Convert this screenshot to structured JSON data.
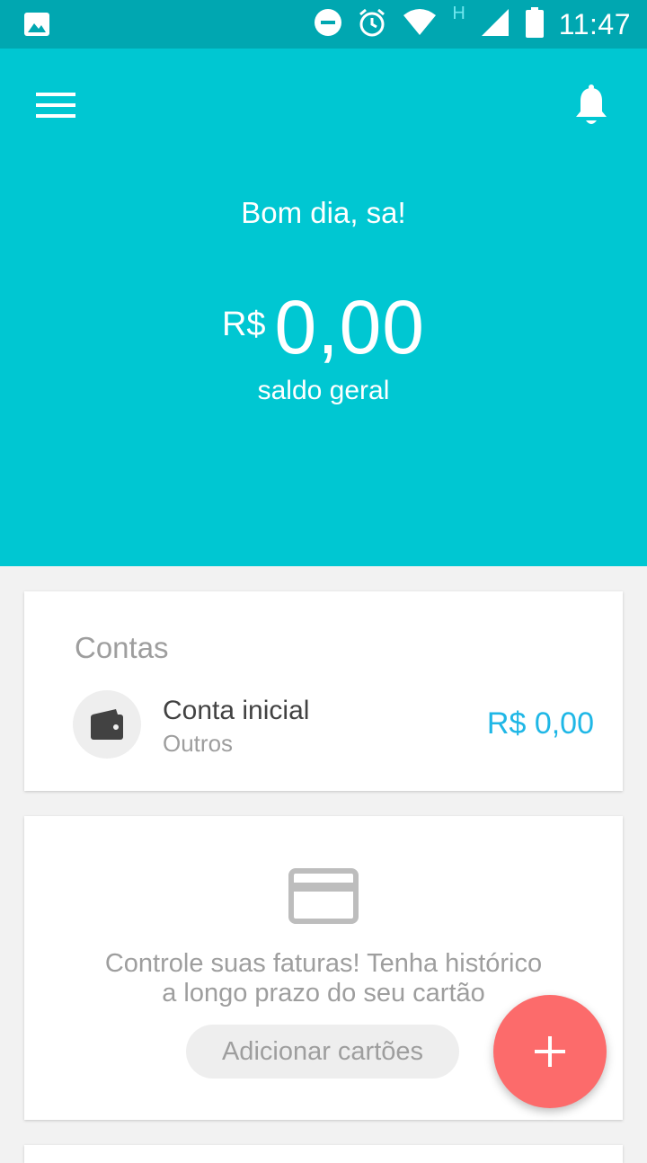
{
  "status_bar": {
    "time": "11:47",
    "network_type": "H",
    "icons": [
      "image-icon",
      "do-not-disturb-icon",
      "alarm-icon",
      "wifi-icon",
      "signal-icon",
      "battery-icon"
    ]
  },
  "header": {
    "menu_icon": "menu-icon",
    "notification_icon": "bell-icon",
    "greeting": "Bom dia, sa!",
    "balance_currency": "R$",
    "balance_amount": "0,00",
    "balance_label": "saldo geral",
    "background_color": "#00c7d2"
  },
  "accounts_card": {
    "title": "Contas",
    "accounts": [
      {
        "icon": "wallet-icon",
        "name": "Conta inicial",
        "type": "Outros",
        "balance": "R$ 0,00",
        "balance_color": "#1fb7e6"
      }
    ]
  },
  "cards_card": {
    "icon": "credit-card-icon",
    "message_line1": "Controle suas faturas! Tenha histórico",
    "message_line2": "a longo prazo do seu cartão",
    "button_label": "Adicionar cartões"
  },
  "fab": {
    "icon": "plus-icon",
    "color": "#fc6b6b"
  }
}
